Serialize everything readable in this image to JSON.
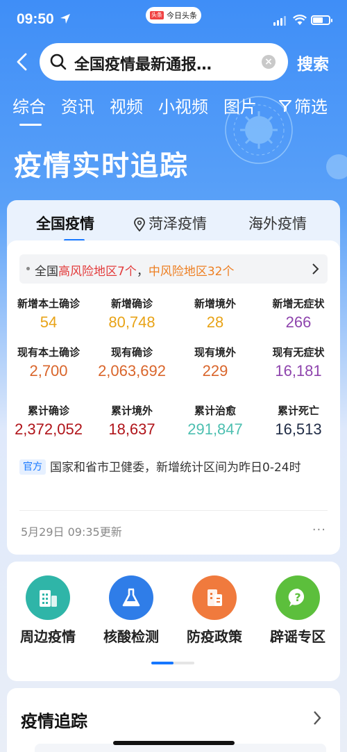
{
  "status": {
    "time": "09:50",
    "app_pill": "今日头条",
    "app_logo": "头条"
  },
  "search": {
    "query": "全国疫情最新通报…",
    "button": "搜索"
  },
  "tabs": [
    "综合",
    "资讯",
    "视频",
    "小视频",
    "图片"
  ],
  "filter_label": "筛选",
  "hero_title": "疫情实时追踪",
  "region_tabs": {
    "national": "全国疫情",
    "local": "菏泽疫情",
    "overseas": "海外疫情"
  },
  "risk": {
    "prefix": "全国",
    "high": "高风险地区7个",
    "sep": "，",
    "mid": "中风险地区32个"
  },
  "stats": [
    {
      "label": "新增本土确诊",
      "value": "54",
      "color": "#e8a317"
    },
    {
      "label": "新增确诊",
      "value": "80,748",
      "color": "#e8a317"
    },
    {
      "label": "新增境外",
      "value": "28",
      "color": "#e8a317"
    },
    {
      "label": "新增无症状",
      "value": "266",
      "color": "#8e44ad"
    },
    {
      "label": "现有本土确诊",
      "value": "2,700",
      "color": "#d9652b"
    },
    {
      "label": "现有确诊",
      "value": "2,063,692",
      "color": "#d9652b"
    },
    {
      "label": "现有境外",
      "value": "229",
      "color": "#d9652b"
    },
    {
      "label": "现有无症状",
      "value": "16,181",
      "color": "#8e44ad"
    },
    {
      "label": "累计确诊",
      "value": "2,372,052",
      "color": "#b0141a"
    },
    {
      "label": "累计境外",
      "value": "18,637",
      "color": "#b0141a"
    },
    {
      "label": "累计治愈",
      "value": "291,847",
      "color": "#4cbfb0"
    },
    {
      "label": "累计死亡",
      "value": "16,513",
      "color": "#1e2a44"
    }
  ],
  "source": {
    "badge": "官方",
    "text": "国家和省市卫健委，新增统计区间为昨日0-24时"
  },
  "update_time": "5月29日 09:35更新",
  "more": "···",
  "quick_entries": [
    {
      "label": "周边疫情",
      "color": "#2fb5a8",
      "icon": "buildings-icon"
    },
    {
      "label": "核酸检测",
      "color": "#2f7de8",
      "icon": "flask-icon"
    },
    {
      "label": "防疫政策",
      "color": "#f07a3d",
      "icon": "building-icon"
    },
    {
      "label": "辟谣专区",
      "color": "#5cbf3c",
      "icon": "question-bubble-icon"
    }
  ],
  "tracking_title": "疫情追踪"
}
